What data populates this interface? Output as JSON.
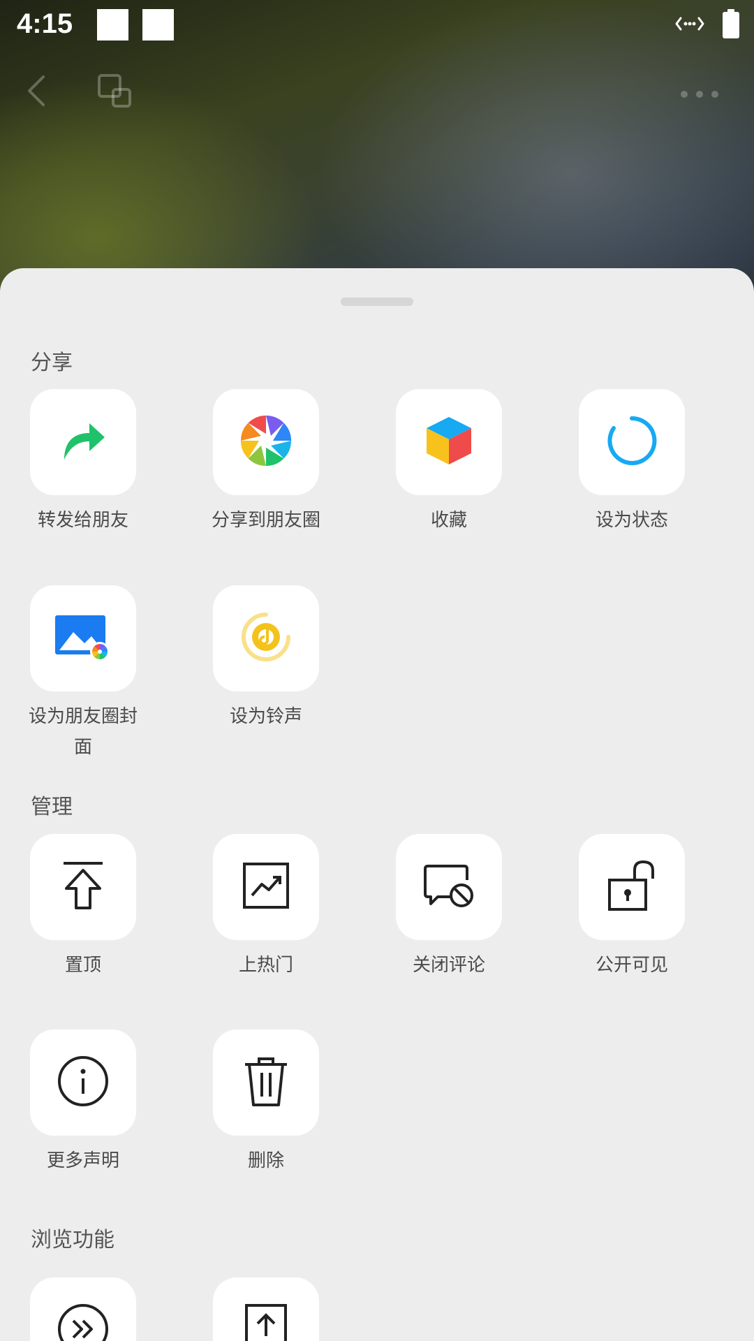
{
  "status_bar": {
    "time": "4:15"
  },
  "sheet": {
    "sections": [
      {
        "title": "分享",
        "items": [
          {
            "label": "转发给朋友",
            "icon": "forward-arrow-icon"
          },
          {
            "label": "分享到朋友圈",
            "icon": "moments-aperture-icon"
          },
          {
            "label": "收藏",
            "icon": "favorites-cube-icon"
          },
          {
            "label": "设为状态",
            "icon": "status-ring-icon"
          },
          {
            "label": "设为朋友圈封面",
            "icon": "moments-cover-icon"
          },
          {
            "label": "设为铃声",
            "icon": "ringtone-icon"
          }
        ]
      },
      {
        "title": "管理",
        "items": [
          {
            "label": "置顶",
            "icon": "pin-top-icon"
          },
          {
            "label": "上热门",
            "icon": "trending-chart-icon"
          },
          {
            "label": "关闭评论",
            "icon": "comments-off-icon"
          },
          {
            "label": "公开可见",
            "icon": "unlock-icon"
          },
          {
            "label": "更多声明",
            "icon": "info-icon"
          },
          {
            "label": "删除",
            "icon": "trash-icon"
          }
        ]
      },
      {
        "title": "浏览功能",
        "items": [
          {
            "icon": "fast-forward-icon"
          },
          {
            "icon": "upload-icon"
          }
        ]
      }
    ]
  },
  "colors": {
    "sheet_bg": "#ededed",
    "tile_bg": "#ffffff",
    "label_text": "#4a4a4a",
    "forward_green": "#1fc26a",
    "status_blue": "#17a9f2",
    "ringtone_yellow": "#f3c21b"
  }
}
